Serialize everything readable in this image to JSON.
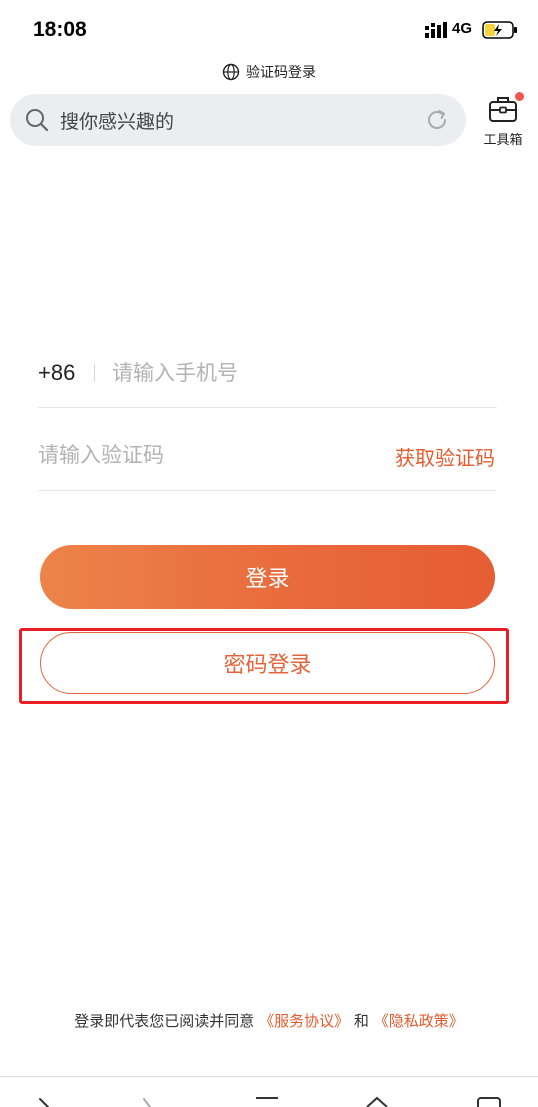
{
  "status_bar": {
    "time": "18:08",
    "network": "4G"
  },
  "page_mode": {
    "label": "验证码登录",
    "icon": "globe-icon"
  },
  "search": {
    "placeholder": "搜你感兴趣的",
    "icon": "search-icon",
    "refresh_icon": "refresh-icon"
  },
  "toolbox": {
    "label": "工具箱",
    "icon": "toolbox-icon",
    "badge_color": "#f2564e"
  },
  "form": {
    "country_code": "+86",
    "phone_placeholder": "请输入手机号",
    "code_placeholder": "请输入验证码",
    "get_code_label": "获取验证码"
  },
  "buttons": {
    "login_label": "登录",
    "password_login_label": "密码登录"
  },
  "agreement": {
    "prefix": "登录即代表您已阅读并同意",
    "service_link": "《服务协议》",
    "conjunction": "和",
    "privacy_link": "《隐私政策》"
  },
  "colors": {
    "accent": "#e45c2e",
    "highlight_border": "#ea1f25",
    "search_bg": "#ebedf0"
  },
  "bottom_nav": {
    "icons": [
      "back-icon",
      "forward-icon",
      "menu-icon",
      "home-icon",
      "tabs-icon"
    ]
  }
}
